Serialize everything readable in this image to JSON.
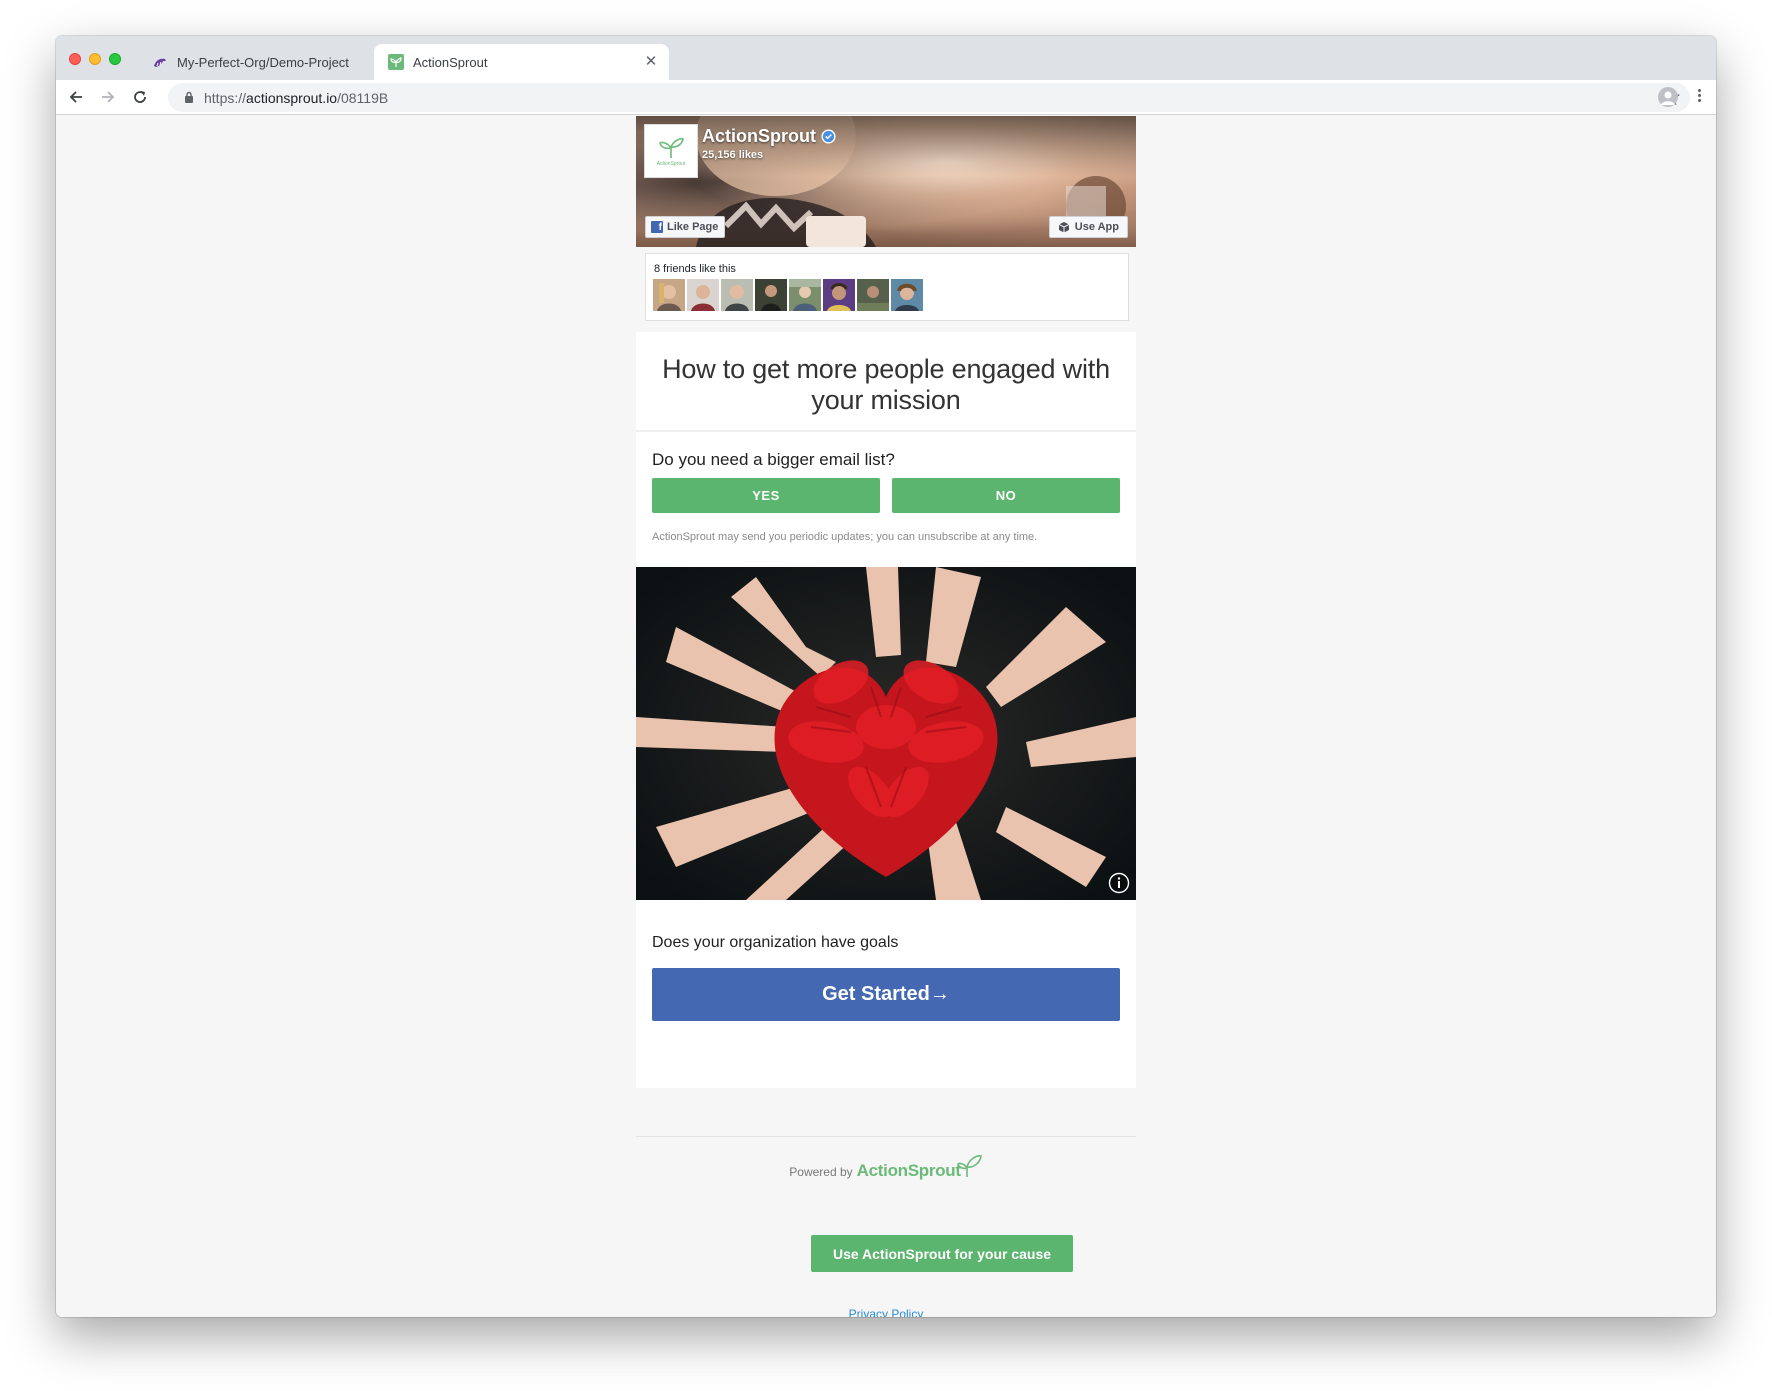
{
  "browser": {
    "tabs": [
      {
        "title": "My-Perfect-Org/Demo-Project",
        "icon": "dinosaur-favicon",
        "active": false
      },
      {
        "title": "ActionSprout",
        "icon": "actionsprout-favicon",
        "active": true
      }
    ],
    "url": {
      "scheme": "https://",
      "host": "actionsprout.io",
      "path": "/08119B"
    }
  },
  "facebook_widget": {
    "page_name": "ActionSprout",
    "likes": "25,156 likes",
    "like_button": "Like Page",
    "use_app_button": "Use App",
    "friends_label": "8 friends like this",
    "friend_count": 8
  },
  "card": {
    "headline": "How to get more people engaged with your mission",
    "question": "Do you need a bigger email list?",
    "yes_label": "YES",
    "no_label": "NO",
    "disclaimer": "ActionSprout may send you periodic updates; you can unsubscribe at any time.",
    "goals_question": "Does your organization have goals",
    "cta_label": "Get Started→"
  },
  "footer": {
    "powered_by": "Powered by",
    "brand": "ActionSprout",
    "use_button": "Use ActionSprout for your cause",
    "privacy_link": "Privacy Policy"
  },
  "colors": {
    "brand_green": "#5cb56f",
    "facebook_blue": "#4468b2",
    "link_blue": "#2a8bd8"
  }
}
